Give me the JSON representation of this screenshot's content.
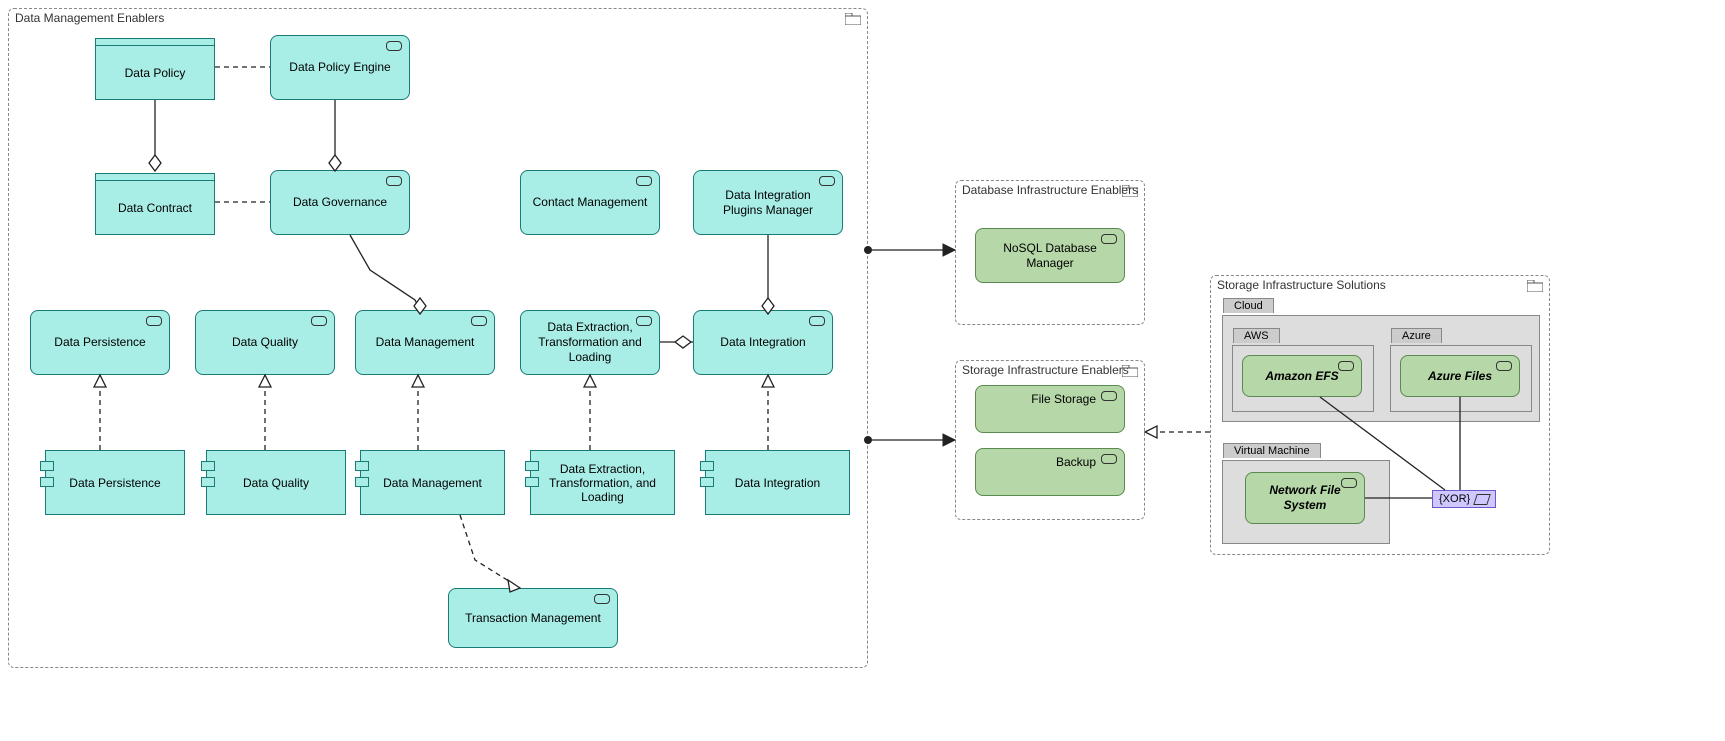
{
  "groups": {
    "dme": "Data Management Enablers",
    "dbie": "Database Infrastructure Enablers",
    "sie": "Storage Infrastructure Enablers",
    "sis": "Storage Infrastructure Solutions",
    "cloud": "Cloud",
    "aws": "AWS",
    "azure": "Azure",
    "vm": "Virtual Machine"
  },
  "nodes": {
    "data_policy": "Data Policy",
    "data_policy_engine": "Data Policy Engine",
    "data_contract": "Data Contract",
    "data_governance": "Data Governance",
    "contact_mgmt": "Contact Management",
    "dip_manager": "Data Integration Plugins Manager",
    "data_persistence": "Data Persistence",
    "data_quality": "Data Quality",
    "data_management": "Data Management",
    "detl": "Data Extraction, Transformation and Loading",
    "data_integration": "Data Integration",
    "comp_data_persistence": "Data Persistence",
    "comp_data_quality": "Data Quality",
    "comp_data_management": "Data Management",
    "comp_detl": "Data Extraction, Transformation, and Loading",
    "comp_data_integration": "Data Integration",
    "transaction_mgmt": "Transaction Management",
    "nosql_mgr": "NoSQL Database Manager",
    "file_storage": "File Storage",
    "backup": "Backup",
    "amazon_efs": "Amazon EFS",
    "azure_files": "Azure Files",
    "nfs": "Network File System",
    "xor": "{XOR}"
  }
}
